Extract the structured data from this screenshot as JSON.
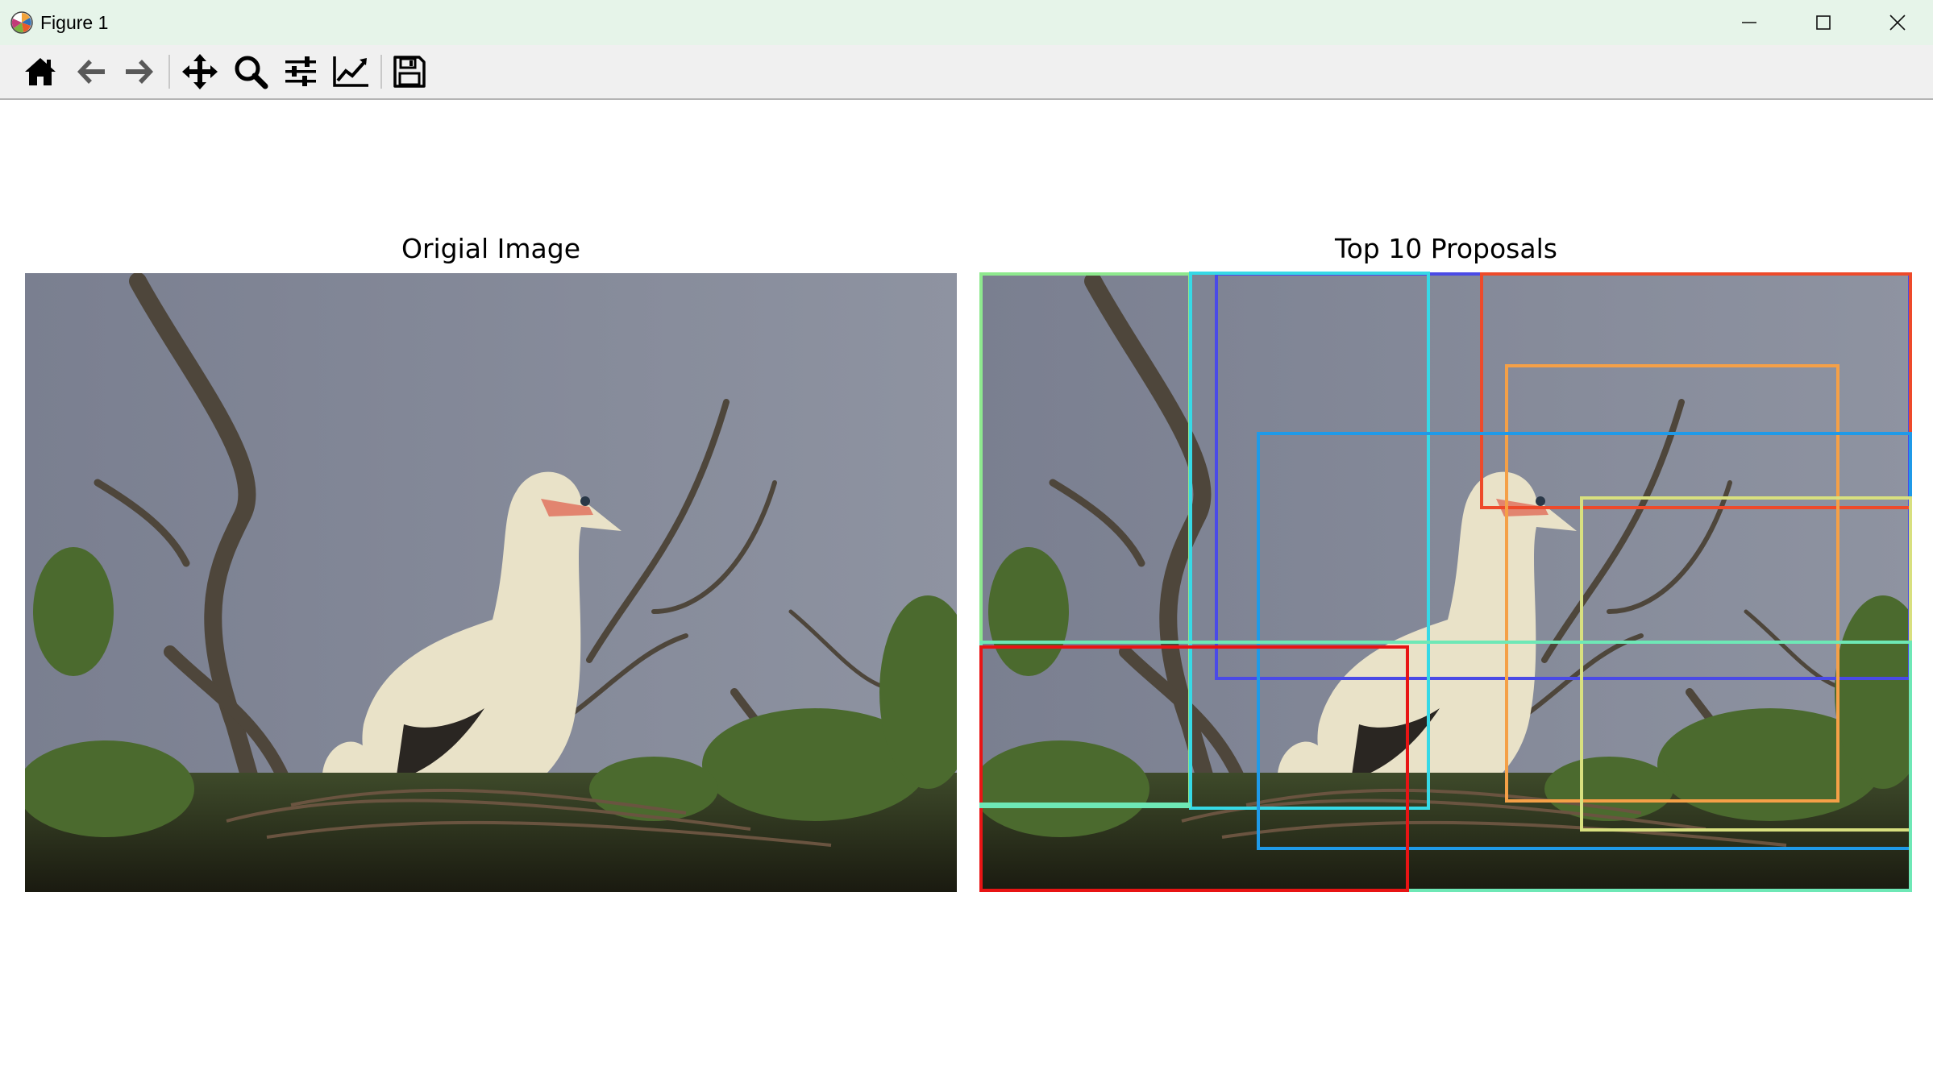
{
  "window": {
    "title": "Figure 1",
    "controls": [
      "minimize",
      "maximize",
      "close"
    ]
  },
  "toolbar": {
    "buttons": [
      {
        "name": "home",
        "icon": "home-icon",
        "tooltip": "Reset original view"
      },
      {
        "name": "back",
        "icon": "arrow-left-icon",
        "tooltip": "Back to previous view"
      },
      {
        "name": "forward",
        "icon": "arrow-right-icon",
        "tooltip": "Forward to next view"
      },
      {
        "name": "pan",
        "icon": "move-icon",
        "tooltip": "Pan axes"
      },
      {
        "name": "zoom",
        "icon": "magnifier-icon",
        "tooltip": "Zoom to rectangle"
      },
      {
        "name": "subplots",
        "icon": "sliders-icon",
        "tooltip": "Configure subplots"
      },
      {
        "name": "axes",
        "icon": "line-chart-icon",
        "tooltip": "Edit axis"
      },
      {
        "name": "save",
        "icon": "floppy-disk-icon",
        "tooltip": "Save the figure"
      }
    ]
  },
  "figure": {
    "left_panel": {
      "title": "Origial Image"
    },
    "right_panel": {
      "title": "Top 10 Proposals"
    },
    "proposals": [
      {
        "color": "#8ee98e"
      },
      {
        "color": "#4a4ae6"
      },
      {
        "color": "#36d9e6"
      },
      {
        "color": "#ee4a2a"
      },
      {
        "color": "#f5a047"
      },
      {
        "color": "#1f9ae8"
      },
      {
        "color": "#d8e07f"
      },
      {
        "color": "#6ee8b6"
      },
      {
        "color": "#e81414"
      },
      {
        "color": "#6ee8b6"
      }
    ]
  }
}
